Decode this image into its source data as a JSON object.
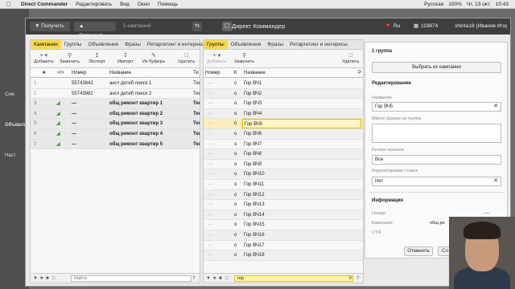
{
  "menubar": {
    "app": "Direct Commander",
    "items": [
      "Редактировать",
      "Вид",
      "Окно",
      "Помощь"
    ],
    "status": [
      "Русская",
      "100%",
      "Чт, 13 окт.",
      "10:43"
    ]
  },
  "window": {
    "title": "Директ Коммандер",
    "get": "Получить",
    "send": "Отправить",
    "campaigns_count": "5 кампаний",
    "lang": "Ru",
    "balance": "119874",
    "user": "shinta18 (Иванов Игорь)"
  },
  "left_bg": [
    "Сем",
    "Объявле",
    "Наст"
  ],
  "left_panel": {
    "tabs": [
      "Кампании",
      "Группы",
      "Объявления",
      "Фразы",
      "Ретаргетинг и интересы"
    ],
    "active_tab": 0,
    "tools": [
      "Добавить",
      "Заменить",
      "Экспорт",
      "Импорт",
      "Из буфера",
      "Удалить"
    ],
    "columns": [
      "Номер",
      "Название",
      "Ти"
    ],
    "rows": [
      {
        "num": "55743842",
        "name": "англ детиб поиск 1",
        "type": "Тек",
        "bold": false
      },
      {
        "num": "55743982",
        "name": "англ детиб поиск 2",
        "type": "Тек",
        "bold": false
      },
      {
        "num": "—",
        "name": "общ ремонт квартир 1",
        "type": "Тек",
        "bold": true
      },
      {
        "num": "—",
        "name": "общ ремонт квартир 2",
        "type": "Тек",
        "bold": true
      },
      {
        "num": "—",
        "name": "общ ремонт квартир 3",
        "type": "Тек",
        "bold": true
      },
      {
        "num": "—",
        "name": "общ ремонт квартир 4",
        "type": "Тек",
        "bold": true
      },
      {
        "num": "—",
        "name": "общ ремонт квартир 5",
        "type": "Тек",
        "bold": true
      }
    ],
    "filter_placeholder": "Найти"
  },
  "mid_panel": {
    "tabs": [
      "Группы",
      "Объявления",
      "Фразы",
      "Ретаргетинг и интересы"
    ],
    "active_tab": 0,
    "tools": [
      "Добавить",
      "Заменить",
      "Удалить"
    ],
    "columns": [
      "Номер",
      "К",
      "Название",
      "Р"
    ],
    "rows": [
      "Гор ВЧ1",
      "Гор ВЧ2",
      "Гор ВЧ3",
      "Гор ВЧ4",
      "Гор ВЧ5",
      "Гор ВЧ6",
      "Гор ВЧ7",
      "Гор ВЧ8",
      "Гор ВЧ9",
      "Гор ВЧ10",
      "Гор ВЧ11",
      "Гор ВЧ12",
      "Гор ВЧ13",
      "Гор ВЧ14",
      "Гор ВЧ15",
      "Гор ВЧ16",
      "Гор ВЧ17",
      "Гор ВЧ18"
    ],
    "selected": 4,
    "filter_value": "гор"
  },
  "right_panel": {
    "group_count": "1 группа",
    "pick_campaigns": "Выбрать их кампании",
    "edit_title": "Редактирование",
    "name_label": "Название",
    "name_value": "Гор ВЧ5",
    "minus_label": "Минус-фразы на группу",
    "region_label": "Регион показов",
    "region_value": "Все",
    "bid_label": "Корректировки ставок",
    "bid_value": "Нет",
    "info_title": "Информация",
    "info_rows": [
      [
        "Номер",
        "—"
      ],
      [
        "Кампания",
        "общ ре"
      ],
      [
        "СТЯ",
        ""
      ]
    ],
    "cancel": "Отменить",
    "save": "Со"
  }
}
